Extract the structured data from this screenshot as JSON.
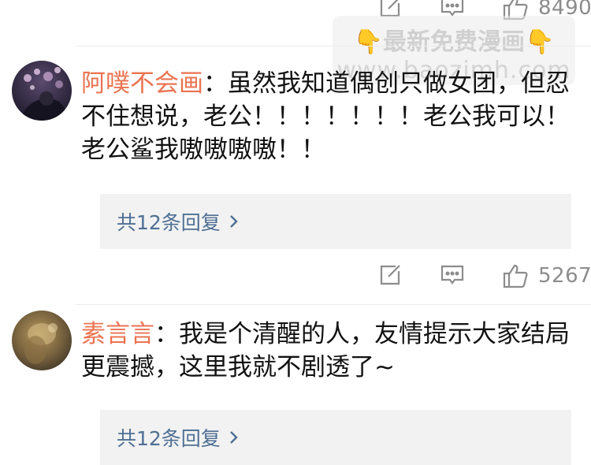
{
  "top_actions": {
    "like_count": "8490"
  },
  "comments": [
    {
      "username": "阿噗不会画",
      "text": "：虽然我知道偶创只做女团，但忍不住想说，老公！！！！！！！老公我可以！老公鲨我嗷嗷嗷嗷！！",
      "reply_label": "共12条回复",
      "like_count": "5267"
    },
    {
      "username": "素言言",
      "text": "：我是个清醒的人，友情提示大家结局更震撼，这里我就不剧透了~",
      "reply_label": "共12条回复"
    }
  ],
  "watermark": {
    "title": "最新免费漫画",
    "url": "www.baozimh.com",
    "hand_emoji": "👇"
  },
  "colors": {
    "username": "#eb7350",
    "reply_link": "#4e6f94",
    "reply_bg": "#f2f2f2",
    "icon": "#8c8c8c"
  },
  "icons": [
    "edit-icon",
    "comment-icon",
    "thumbs-up-icon",
    "chevron-right-icon"
  ]
}
